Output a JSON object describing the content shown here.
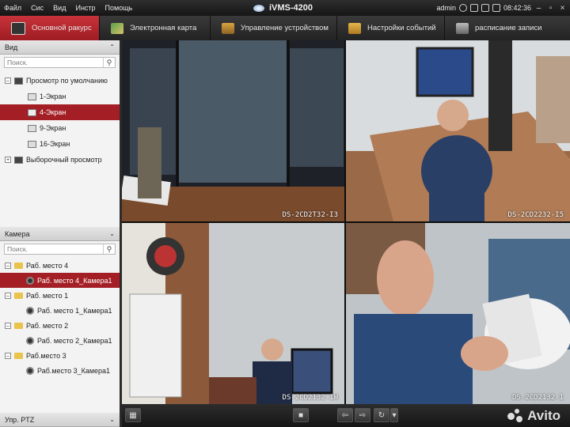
{
  "menu": {
    "items": [
      "Файл",
      "Сис",
      "Вид",
      "Инстр",
      "Помощь"
    ]
  },
  "app_title": "iVMS-4200",
  "status": {
    "user": "admin",
    "time": "08:42:36"
  },
  "tabs": [
    {
      "label": "Основной ракурс",
      "icon": "monitor-icon",
      "active": true
    },
    {
      "label": "Электронная карта",
      "icon": "map-icon"
    },
    {
      "label": "Управление устройством",
      "icon": "device-icon"
    },
    {
      "label": "Настройки событий",
      "icon": "event-folder-icon"
    },
    {
      "label": "расписание записи",
      "icon": "record-schedule-icon"
    }
  ],
  "view_panel": {
    "title": "Вид",
    "search_placeholder": "Поиск.",
    "tree": [
      {
        "label": "Просмотр по умолчанию",
        "expanded": true
      },
      {
        "label": "1-Экран"
      },
      {
        "label": "4-Экран",
        "selected": true
      },
      {
        "label": "9-Экран"
      },
      {
        "label": "16-Экран"
      },
      {
        "label": "Выборочный просмотр",
        "expanded": false
      }
    ]
  },
  "camera_panel": {
    "title": "Камера",
    "search_placeholder": "Поиск.",
    "tree": [
      {
        "label": "Раб. место 4",
        "type": "group"
      },
      {
        "label": "Раб. место 4_Камера1",
        "type": "camera",
        "selected": true
      },
      {
        "label": "Раб. место 1",
        "type": "group"
      },
      {
        "label": "Раб. место 1_Камера1",
        "type": "camera"
      },
      {
        "label": "Раб. место 2",
        "type": "group"
      },
      {
        "label": "Раб. место 2_Камера1",
        "type": "camera"
      },
      {
        "label": "Раб.место 3",
        "type": "group"
      },
      {
        "label": "Раб.место 3_Камера1",
        "type": "camera"
      }
    ]
  },
  "ptz_panel": {
    "title": "Упр. PTZ"
  },
  "videos": [
    {
      "label": "DS-2CD2T32-I3"
    },
    {
      "label": "DS-2CD2232-I5"
    },
    {
      "label": "DS-2CD2132-IW"
    },
    {
      "label": "DS-2CD2132-I"
    }
  ],
  "watermark": "Avito",
  "colors": {
    "accent": "#a41f25",
    "tab_active": "#b3262d"
  }
}
